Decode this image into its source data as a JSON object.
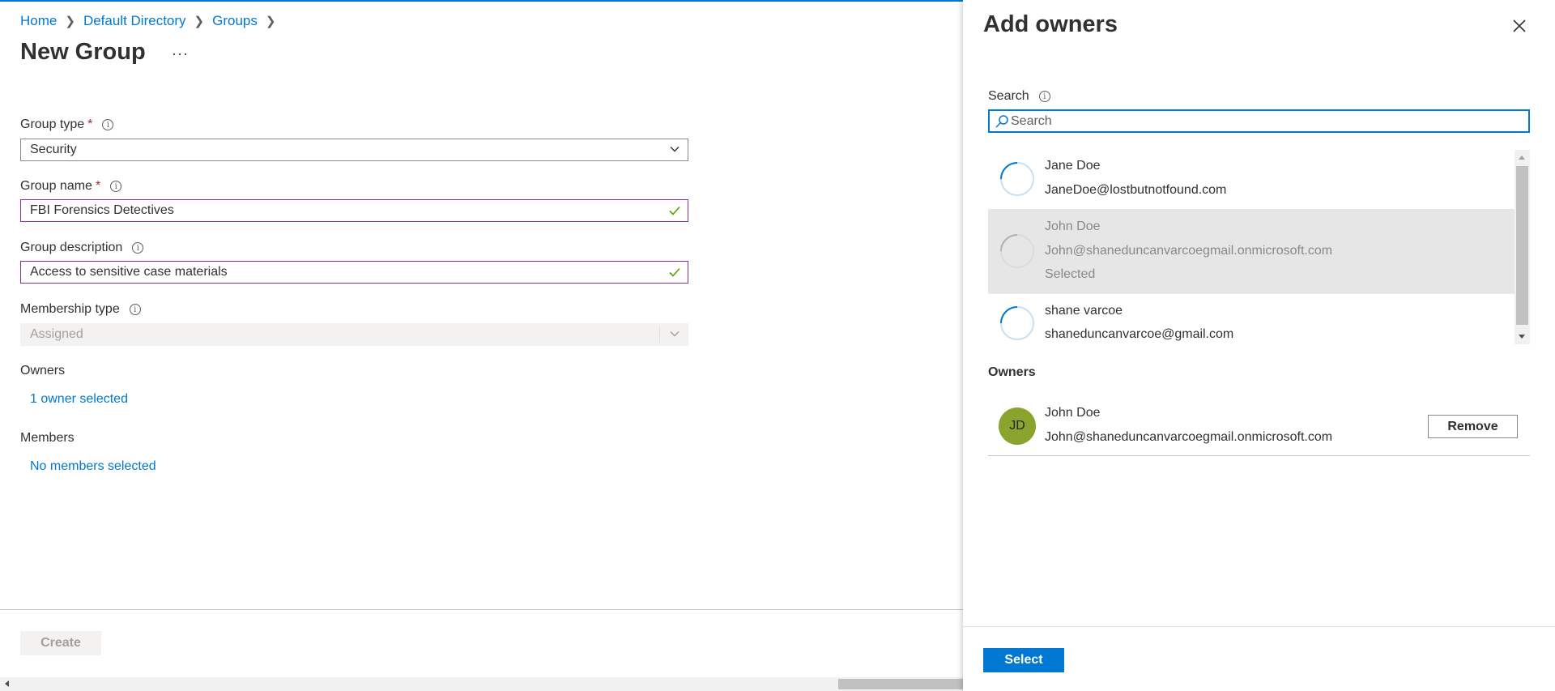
{
  "breadcrumb": {
    "items": [
      "Home",
      "Default Directory",
      "Groups"
    ]
  },
  "page": {
    "title": "New Group",
    "more": "···"
  },
  "form": {
    "group_type": {
      "label": "Group type",
      "required": "*",
      "value": "Security"
    },
    "group_name": {
      "label": "Group name",
      "required": "*",
      "value": "FBI Forensics Detectives"
    },
    "group_description": {
      "label": "Group description",
      "value": "Access to sensitive case materials"
    },
    "membership_type": {
      "label": "Membership type",
      "value": "Assigned"
    },
    "owners": {
      "label": "Owners",
      "link": "1 owner selected"
    },
    "members": {
      "label": "Members",
      "link": "No members selected"
    },
    "create_label": "Create"
  },
  "panel": {
    "title": "Add owners",
    "search_label": "Search",
    "search_placeholder": "Search",
    "results": [
      {
        "name": "Jane Doe",
        "email": "JaneDoe@lostbutnotfound.com",
        "selected": false,
        "selected_label": ""
      },
      {
        "name": "John Doe",
        "email": "John@shaneduncanvarcoegmail.onmicrosoft.com",
        "selected": true,
        "selected_label": "Selected"
      },
      {
        "name": "shane varcoe",
        "email": "shaneduncanvarcoe@gmail.com",
        "selected": false,
        "selected_label": ""
      }
    ],
    "owners_heading": "Owners",
    "owners": [
      {
        "initials": "JD",
        "name": "John Doe",
        "email": "John@shaneduncanvarcoegmail.onmicrosoft.com",
        "remove_label": "Remove",
        "avatar_color": "#8ba42e"
      }
    ],
    "select_label": "Select"
  },
  "colors": {
    "accent": "#0078d4",
    "valid_border": "#8a2ba0",
    "check": "#57a300",
    "required": "#a4262c"
  }
}
